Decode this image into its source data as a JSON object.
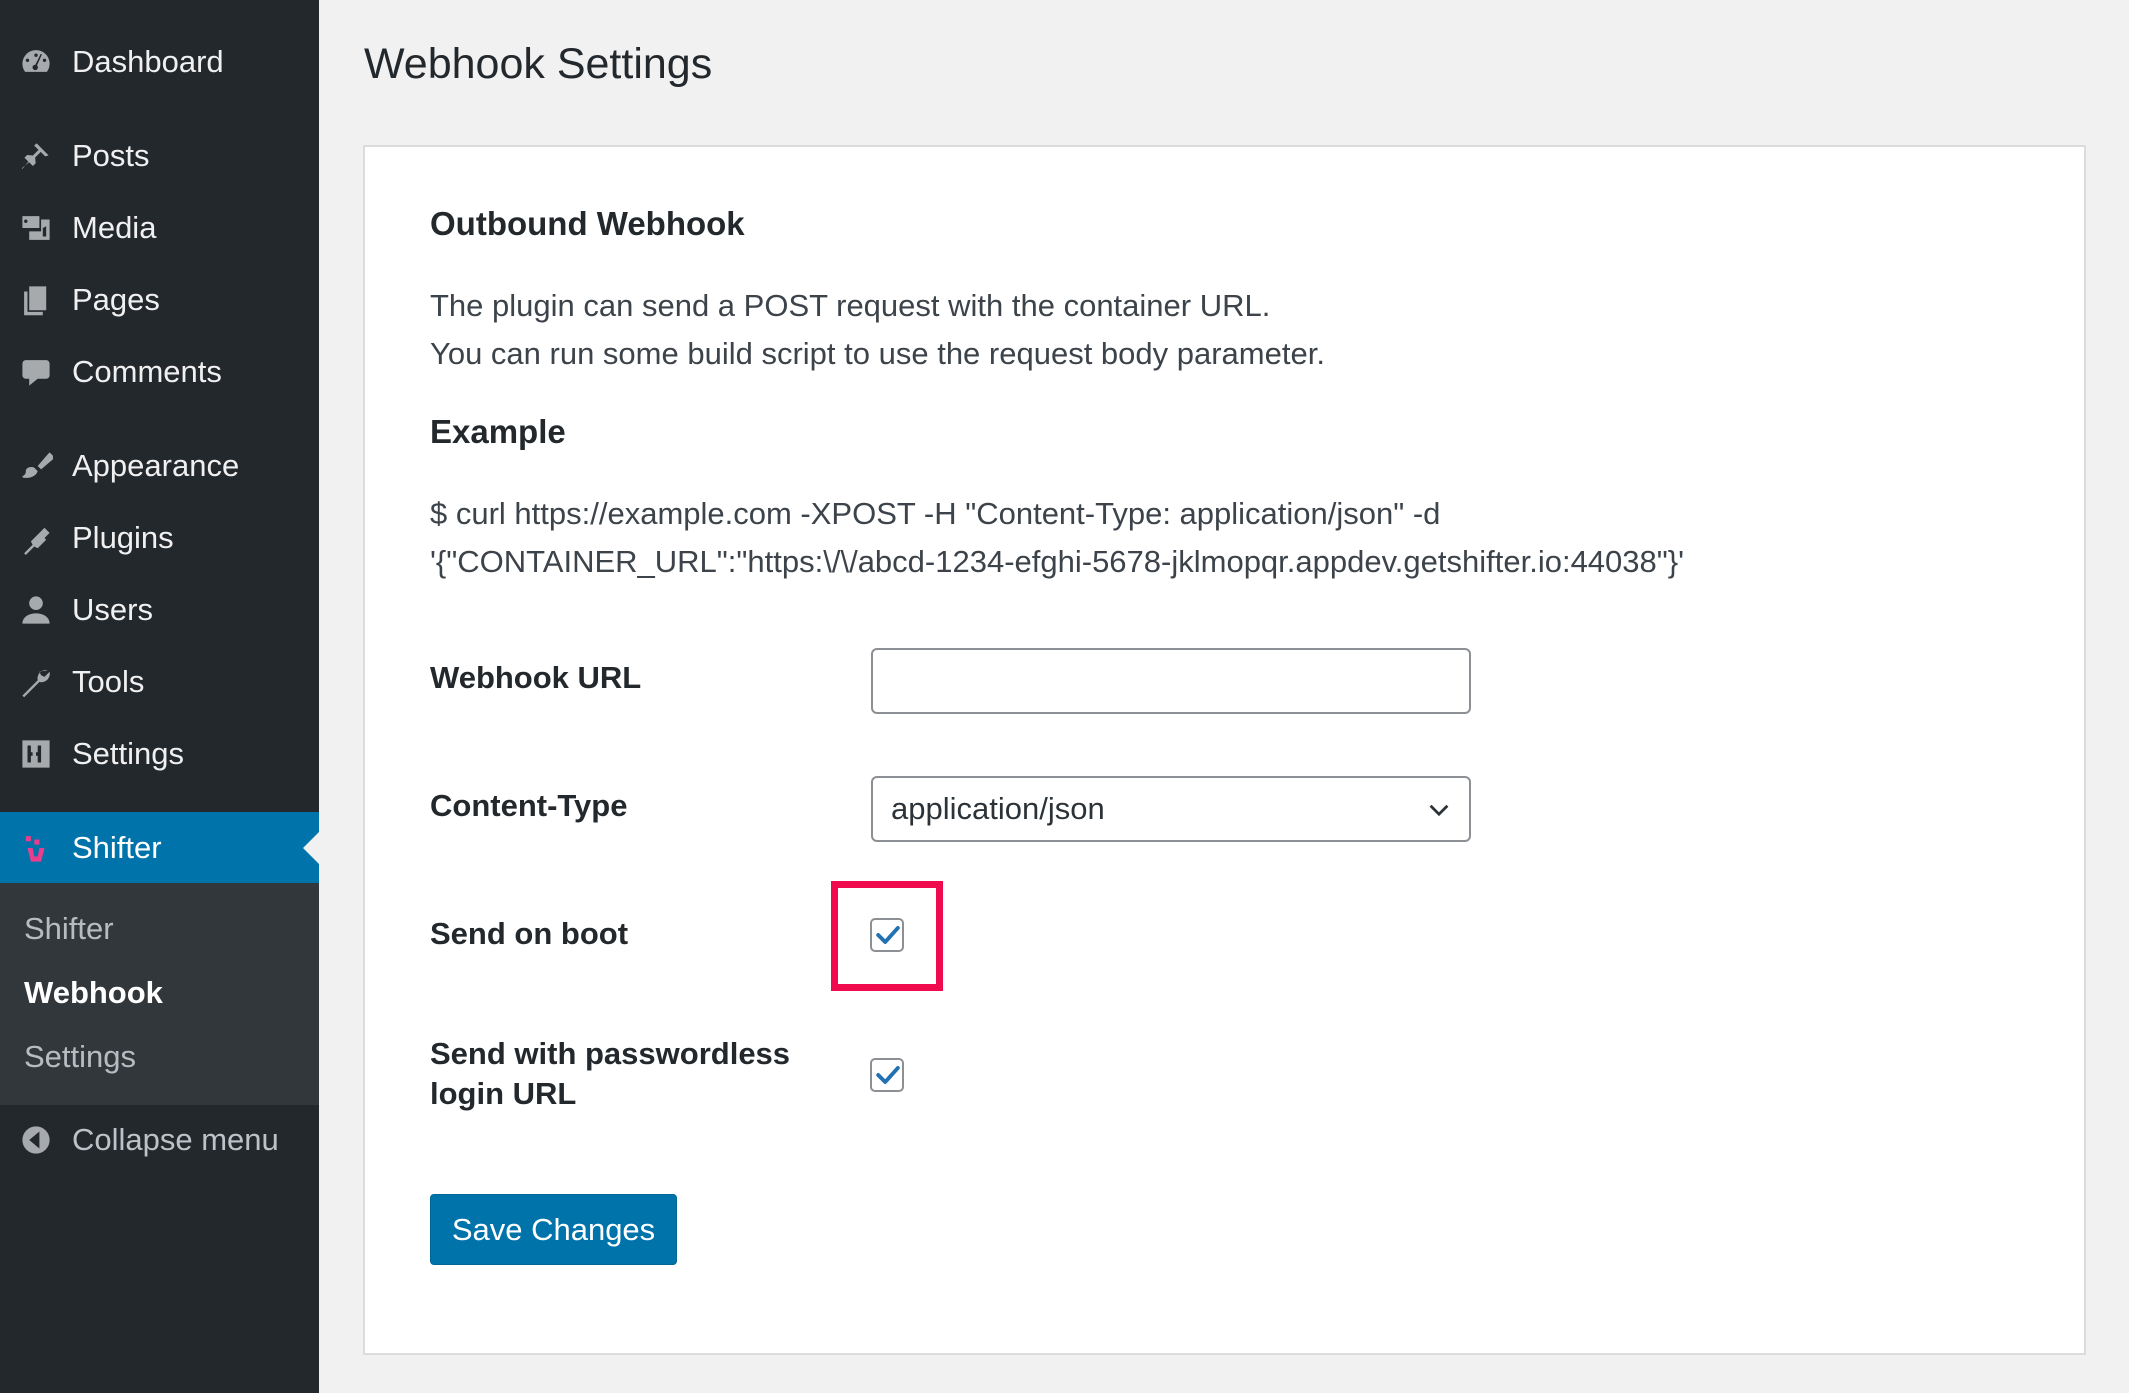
{
  "sidebar": {
    "items": [
      {
        "label": "Dashboard",
        "icon": "dashboard-icon"
      },
      {
        "label": "Posts",
        "icon": "pushpin-icon"
      },
      {
        "label": "Media",
        "icon": "media-icon"
      },
      {
        "label": "Pages",
        "icon": "pages-icon"
      },
      {
        "label": "Comments",
        "icon": "comment-icon"
      },
      {
        "label": "Appearance",
        "icon": "paintbrush-icon"
      },
      {
        "label": "Plugins",
        "icon": "plugin-icon"
      },
      {
        "label": "Users",
        "icon": "user-icon"
      },
      {
        "label": "Tools",
        "icon": "wrench-icon"
      },
      {
        "label": "Settings",
        "icon": "settings-icon"
      },
      {
        "label": "Shifter",
        "icon": "shifter-logo-icon"
      }
    ],
    "submenu": [
      "Shifter",
      "Webhook",
      "Settings"
    ],
    "collapse_label": "Collapse menu",
    "active_color": "#0073aa"
  },
  "page": {
    "title": "Webhook Settings"
  },
  "outbound": {
    "heading": "Outbound Webhook",
    "desc_line1": "The plugin can send a POST request with the container URL.",
    "desc_line2": "You can run some build script to use the request body parameter."
  },
  "example": {
    "heading": "Example",
    "line1": "$ curl https://example.com -XPOST -H \"Content-Type: application/json\" -d",
    "line2": "'{\"CONTAINER_URL\":\"https:\\/\\/abcd-1234-efghi-5678-jklmopqr.appdev.getshifter.io:44038\"}'"
  },
  "form": {
    "webhook_url_label": "Webhook URL",
    "webhook_url_value": "",
    "content_type_label": "Content-Type",
    "content_type_value": "application/json",
    "send_on_boot_label": "Send on boot",
    "send_on_boot_checked": true,
    "passwordless_label_line1": "Send with passwordless",
    "passwordless_label_line2": "login URL",
    "passwordless_checked": true,
    "save_label": "Save Changes"
  },
  "colors": {
    "highlight": "#ef0b4d",
    "primary": "#0073aa",
    "check": "#2271b1"
  }
}
